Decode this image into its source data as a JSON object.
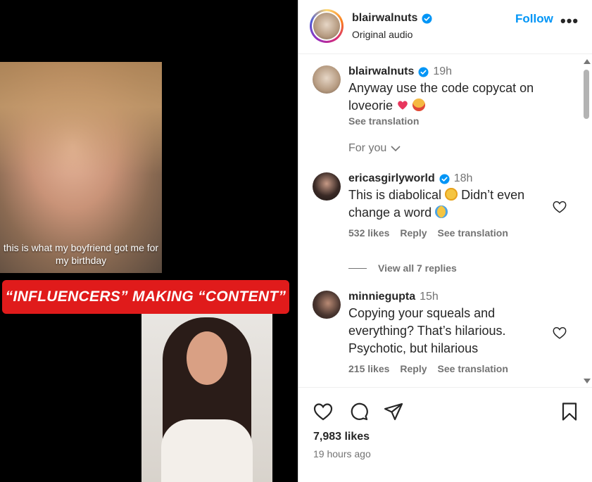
{
  "video": {
    "caption": "this is what my boyfriend got me for my birthday",
    "banner": "“INFLUENCERS” MAKING “CONTENT”"
  },
  "post_header": {
    "username": "blairwalnuts",
    "subtitle": "Original audio",
    "follow_label": "Follow",
    "more_label": "•••"
  },
  "caption_comment": {
    "username": "blairwalnuts",
    "time": "19h",
    "text": "Anyway use the code copycat on loveorie",
    "see_translation": "See translation"
  },
  "for_you": "For you",
  "comments": [
    {
      "username": "ericasgirlyworld",
      "time": "18h",
      "text_a": "This is diabolical",
      "text_b": "Didn’t even change a word",
      "likes": "532 likes",
      "reply": "Reply",
      "see_translation": "See translation"
    },
    {
      "username": "minniegupta",
      "time": "15h",
      "text": "Copying your squeals and everything? That’s hilarious. Psychotic, but hilarious",
      "likes": "215 likes",
      "reply": "Reply",
      "see_translation": "See translation"
    }
  ],
  "view_replies": "View all 7 replies",
  "footer": {
    "likes": "7,983 likes",
    "time_ago": "19 hours ago"
  },
  "colors": {
    "accent": "#0095f6",
    "banner_red": "#e01b1b",
    "muted": "#737373"
  },
  "icons": [
    "heart-icon",
    "comment-icon",
    "share-icon",
    "bookmark-icon",
    "verified-icon",
    "chevron-down-icon",
    "more-icon"
  ]
}
